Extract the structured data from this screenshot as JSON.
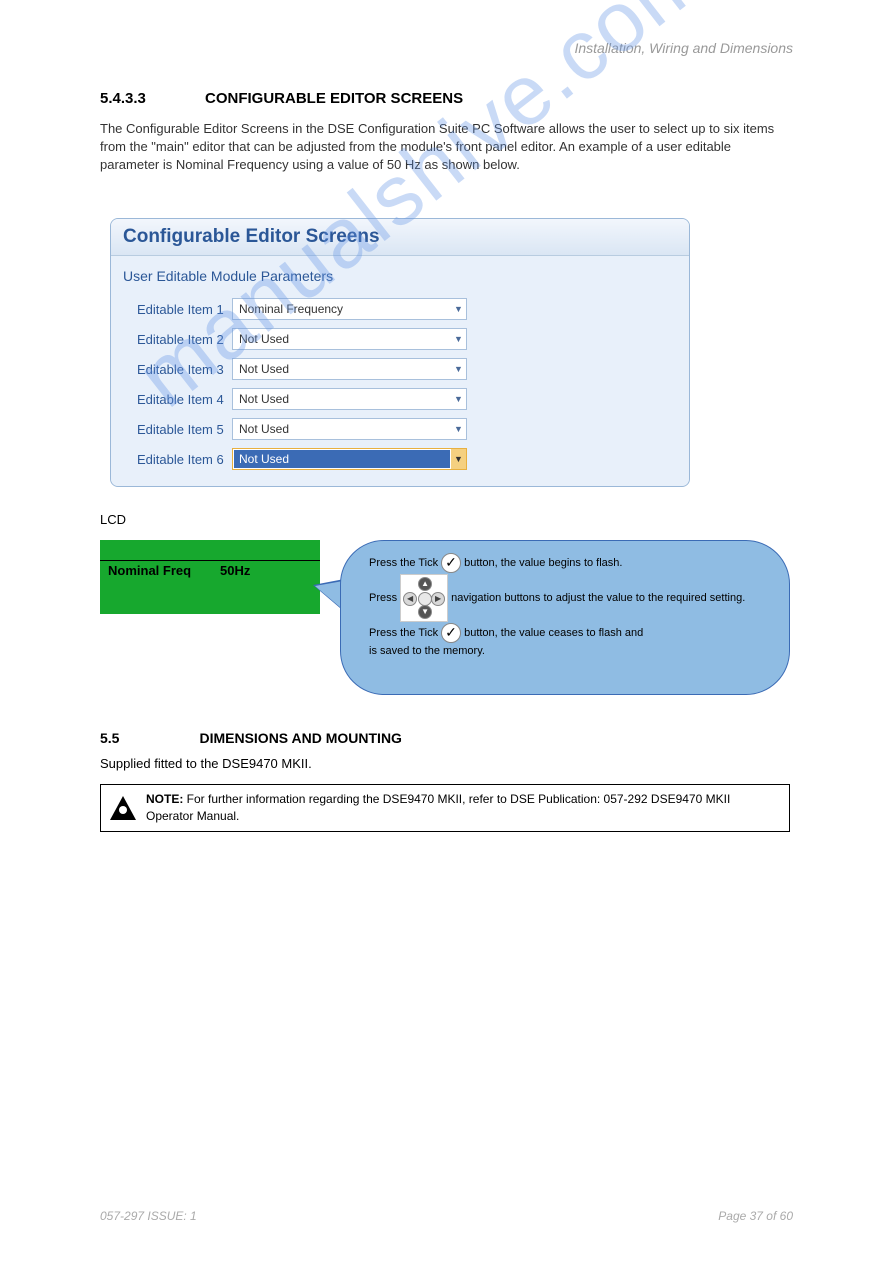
{
  "header": "Installation, Wiring and Dimensions",
  "section": {
    "number": "5.4.3.3",
    "title": "CONFIGURABLE EDITOR SCREENS",
    "intro": "The Configurable Editor Screens in the DSE Configuration Suite PC Software allows the user to select up to six items from the \"main\" editor that can be adjusted from the module's front panel editor. An example of a user editable parameter is Nominal Frequency using a value of 50 Hz as shown below."
  },
  "panel": {
    "title": "Configurable Editor Screens",
    "subtitle": "User Editable Module Parameters",
    "items": [
      {
        "label": "Editable Item 1",
        "value": "Nominal Frequency"
      },
      {
        "label": "Editable Item 2",
        "value": "Not Used"
      },
      {
        "label": "Editable Item 3",
        "value": "Not Used"
      },
      {
        "label": "Editable Item 4",
        "value": "Not Used"
      },
      {
        "label": "Editable Item 5",
        "value": "Not Used"
      },
      {
        "label": "Editable Item 6",
        "value": "Not Used"
      }
    ]
  },
  "lcd_label": "LCD",
  "lcd": {
    "row_title": "Nominal Freq",
    "row_value": "50Hz"
  },
  "callout": {
    "line1_a": "Press the Tick ",
    "line1_b": " button, the value begins to flash.",
    "line2_a": "Press ",
    "line2_b": "navigation buttons to adjust the value to the required setting.",
    "line3_a": "Press the Tick ",
    "line3_b": " button, the value ceases to flash and",
    "line4": "is saved to the memory."
  },
  "dimensions": {
    "number": "5.5",
    "title": "DIMENSIONS AND MOUNTING",
    "text": "Supplied fitted to the DSE9470 MKII."
  },
  "warning": {
    "prefix": "NOTE: ",
    "text": "For further information regarding the DSE9470 MKII, refer to DSE Publication: 057-292 DSE9470 MKII Operator Manual."
  },
  "footer": {
    "left": "057-297 ISSUE: 1",
    "right": "Page 37 of 60"
  },
  "watermark": "manualshive.com"
}
